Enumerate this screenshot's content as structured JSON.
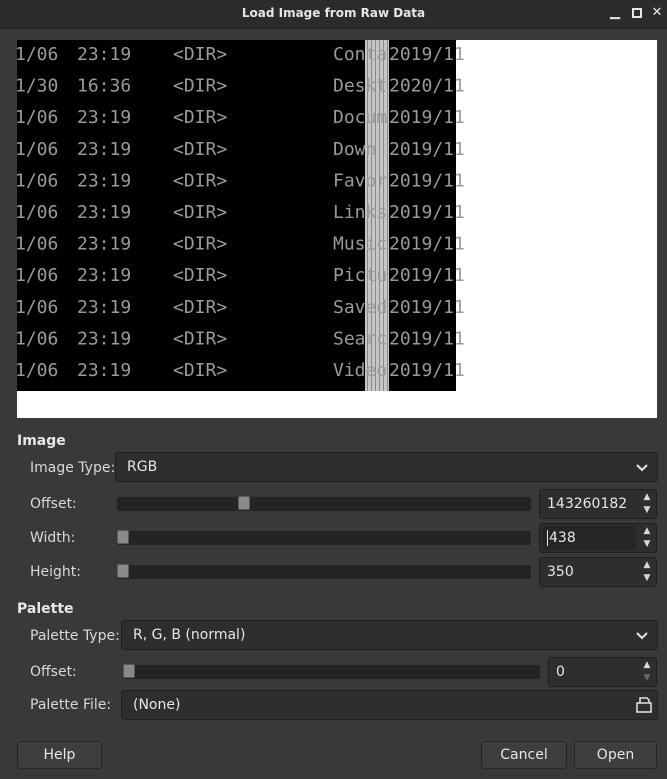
{
  "window": {
    "title": "Load Image from Raw Data"
  },
  "preview": {
    "lines": [
      {
        "date": "1/06",
        "time": "23:19",
        "type": "<DIR>"
      },
      {
        "date": "1/30",
        "time": "16:36",
        "type": "<DIR>"
      },
      {
        "date": "1/06",
        "time": "23:19",
        "type": "<DIR>"
      },
      {
        "date": "1/06",
        "time": "23:19",
        "type": "<DIR>"
      },
      {
        "date": "1/06",
        "time": "23:19",
        "type": "<DIR>"
      },
      {
        "date": "1/06",
        "time": "23:19",
        "type": "<DIR>"
      },
      {
        "date": "1/06",
        "time": "23:19",
        "type": "<DIR>"
      },
      {
        "date": "1/06",
        "time": "23:19",
        "type": "<DIR>"
      },
      {
        "date": "1/06",
        "time": "23:19",
        "type": "<DIR>"
      },
      {
        "date": "1/06",
        "time": "23:19",
        "type": "<DIR>"
      },
      {
        "date": "1/06",
        "time": "23:19",
        "type": "<DIR>"
      }
    ],
    "names": [
      "Conta",
      "Deskt",
      "Docum",
      "Down",
      "Favor",
      "Links",
      "Music",
      "Pictu",
      "Saved",
      "Searc",
      "Video"
    ],
    "overlay": [
      "2019/11",
      "2020/11",
      "2019/11",
      "2019/11",
      "2019/11",
      "2019/11",
      "2019/11",
      "2019/11",
      "2019/11",
      "2019/11",
      "2019/11"
    ]
  },
  "image": {
    "section_label": "Image",
    "image_type_label": "Image Type:",
    "image_type_value": "RGB",
    "offset_label": "Offset:",
    "offset_value": "143260182",
    "offset_fraction": 0.3,
    "width_label": "Width:",
    "width_value": "438",
    "width_fraction": 0.0,
    "height_label": "Height:",
    "height_value": "350",
    "height_fraction": 0.0
  },
  "palette": {
    "section_label": "Palette",
    "type_label": "Palette Type:",
    "type_value": "R, G, B (normal)",
    "offset_label": "Offset:",
    "offset_value": "0",
    "offset_fraction": 0.0,
    "file_label": "Palette File:",
    "file_value": "(None)"
  },
  "buttons": {
    "help": "Help",
    "cancel": "Cancel",
    "open": "Open"
  }
}
